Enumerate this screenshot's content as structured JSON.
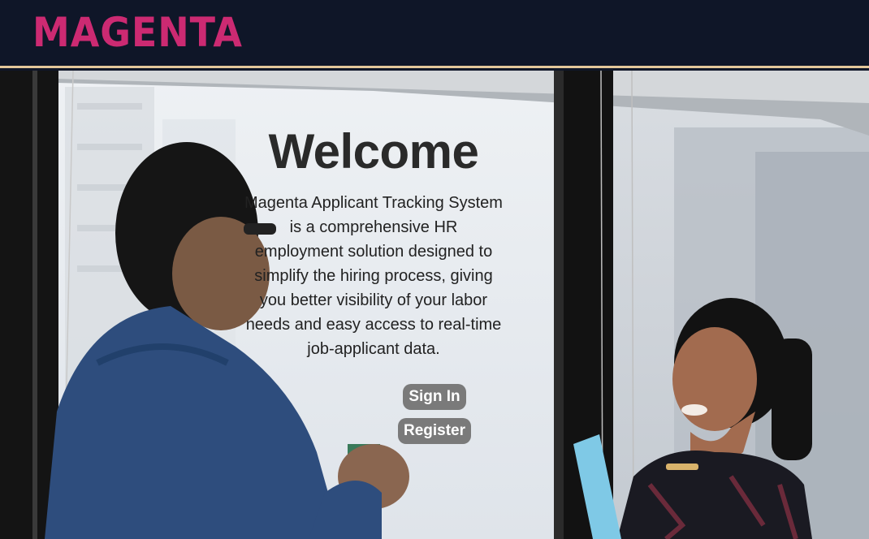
{
  "header": {
    "logo_text": "MAGENTA",
    "logo_color": "#cc2a72",
    "bg_color": "#0f1628",
    "accent_border_color": "#e3c79a"
  },
  "hero": {
    "title": "Welcome",
    "description": "Magenta Applicant Tracking System is a comprehensive HR employment solution designed to simplify the hiring process, giving you better visibility of your labor needs and easy access to real-time job-applicant data.",
    "sign_in_label": "Sign In",
    "register_label": "Register",
    "button_color": "#7a7a7a",
    "background_image": "office-window-people-photo"
  }
}
